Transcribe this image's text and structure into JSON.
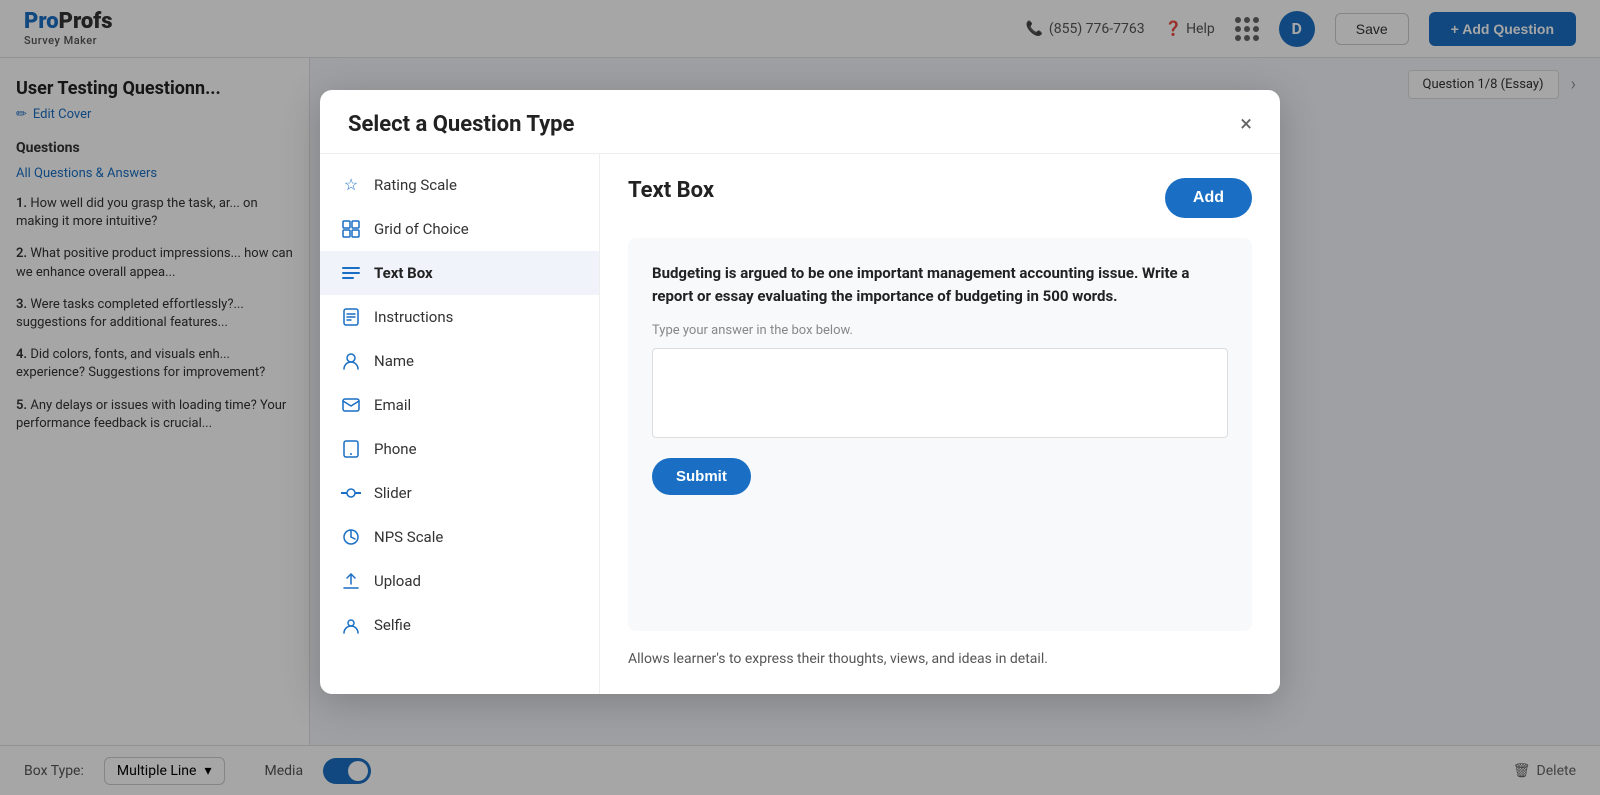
{
  "app": {
    "logo_top": "ProProfs",
    "logo_sub": "Survey Maker",
    "phone": "(855) 776-7763",
    "help": "Help",
    "user_initial": "D"
  },
  "toolbar": {
    "save_label": "Save",
    "add_question_label": "+ Add Question",
    "question_badge": "Question 1/8 (Essay)"
  },
  "sidebar": {
    "page_title": "User Testing Questionn...",
    "edit_cover_label": "Edit Cover",
    "questions_section": "Questions",
    "all_qa_link": "All Questions & Answers",
    "questions": [
      {
        "num": "1.",
        "text": "How well did you grasp the task, ar... on making it more intuitive?"
      },
      {
        "num": "2.",
        "text": "What positive product impressions... how can we enhance overall appea..."
      },
      {
        "num": "3.",
        "text": "Were tasks completed effortlessly?... suggestions for additional features..."
      },
      {
        "num": "4.",
        "text": "Did colors, fonts, and visuals enh... experience? Suggestions for improvement?"
      },
      {
        "num": "5.",
        "text": "Any delays or issues with loading time? Your performance feedback is crucial..."
      }
    ]
  },
  "bottom_bar": {
    "box_type_label": "Box Type:",
    "box_type_value": "Multiple Line",
    "media_label": "Media",
    "delete_label": "Delete"
  },
  "modal": {
    "title": "Select a Question Type",
    "close_icon": "×",
    "type_list": [
      {
        "id": "rating-scale",
        "label": "Rating Scale",
        "icon": "☆"
      },
      {
        "id": "grid-of-choice",
        "label": "Grid of Choice",
        "icon": "⊞"
      },
      {
        "id": "text-box",
        "label": "Text Box",
        "icon": "≡",
        "active": true
      },
      {
        "id": "instructions",
        "label": "Instructions",
        "icon": "📋"
      },
      {
        "id": "name",
        "label": "Name",
        "icon": "👤"
      },
      {
        "id": "email",
        "label": "Email",
        "icon": "✉"
      },
      {
        "id": "phone",
        "label": "Phone",
        "icon": "📞"
      },
      {
        "id": "slider",
        "label": "Slider",
        "icon": "⟺"
      },
      {
        "id": "nps-scale",
        "label": "NPS Scale",
        "icon": "◔"
      },
      {
        "id": "upload",
        "label": "Upload",
        "icon": "↑"
      },
      {
        "id": "selfie",
        "label": "Selfie",
        "icon": "👤"
      }
    ],
    "preview": {
      "title": "Text Box",
      "add_button_label": "Add",
      "question_text": "Budgeting is argued to be one important management accounting issue. Write a report or essay evaluating the importance of budgeting in 500 words.",
      "hint": "Type your answer in the box below.",
      "submit_label": "Submit",
      "description": "Allows learner's to express their thoughts, views, and ideas in detail."
    }
  }
}
